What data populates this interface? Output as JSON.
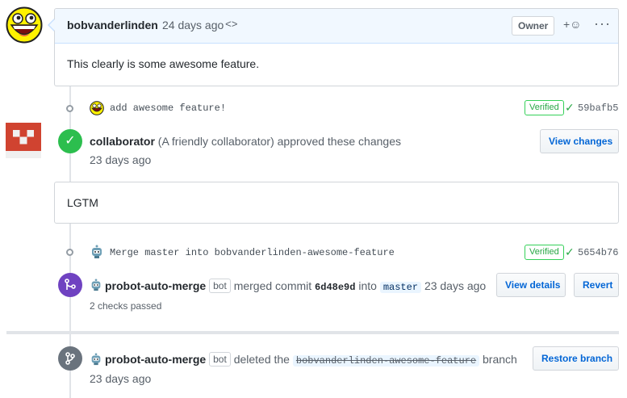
{
  "comment1": {
    "author": "bobvanderlinden",
    "time": "24 days ago",
    "edited_glyph": "<>",
    "owner_label": "Owner",
    "reaction_glyph": "+☺",
    "more_glyph": "···",
    "body": "This clearly is some awesome feature."
  },
  "commit1": {
    "message": "add awesome feature!",
    "verified": "Verified",
    "sha": "59bafb5"
  },
  "review": {
    "author": "collaborator",
    "author_note": "(A friendly collaborator)",
    "action": "approved these changes",
    "time": "23 days ago",
    "view_changes": "View changes",
    "body": "LGTM"
  },
  "commit2": {
    "message": "Merge master into bobvanderlinden-awesome-feature",
    "verified": "Verified",
    "sha": "5654b76"
  },
  "merge_event": {
    "actor": "probot-auto-merge",
    "bot_label": "bot",
    "text_merged": "merged commit",
    "sha": "6d48e9d",
    "text_into": "into",
    "branch": "master",
    "time": "23 days ago",
    "view_details": "View details",
    "revert": "Revert",
    "checks": "2 checks passed"
  },
  "delete_event": {
    "actor": "probot-auto-merge",
    "bot_label": "bot",
    "text_deleted": "deleted the",
    "branch": "bobvanderlinden-awesome-feature",
    "text_branch": "branch",
    "time": "23 days ago",
    "restore": "Restore branch"
  },
  "colors": {
    "approved": "#2cbe4e",
    "merged": "#6f42c1",
    "deleted": "#6a737d",
    "link": "#0366d6"
  }
}
